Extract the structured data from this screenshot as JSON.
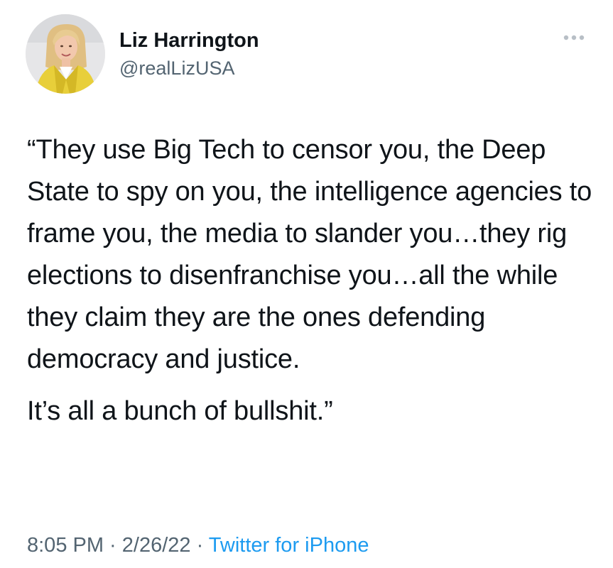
{
  "author": {
    "display_name": "Liz Harrington",
    "handle": "@realLizUSA",
    "avatar_icon": "profile-photo"
  },
  "more_icon": "more-horizontal-icon",
  "tweet": {
    "paragraph_1": "“They use Big Tech to censor you, the Deep State to spy on you, the intelligence agencies to frame you, the media to slander you…they rig elections to disenfranchise you…all the while they claim they are the ones defending democracy and justice.",
    "paragraph_2": "It’s all a bunch of bullshit.”"
  },
  "meta": {
    "time": "8:05 PM",
    "separator": " · ",
    "date": "2/26/22",
    "source": "Twitter for iPhone"
  },
  "colors": {
    "text_primary": "#0f1419",
    "text_secondary": "#536471",
    "link": "#1d9bf0",
    "avatar_jacket": "#e8cf3a",
    "avatar_hair": "#e3c48a"
  }
}
